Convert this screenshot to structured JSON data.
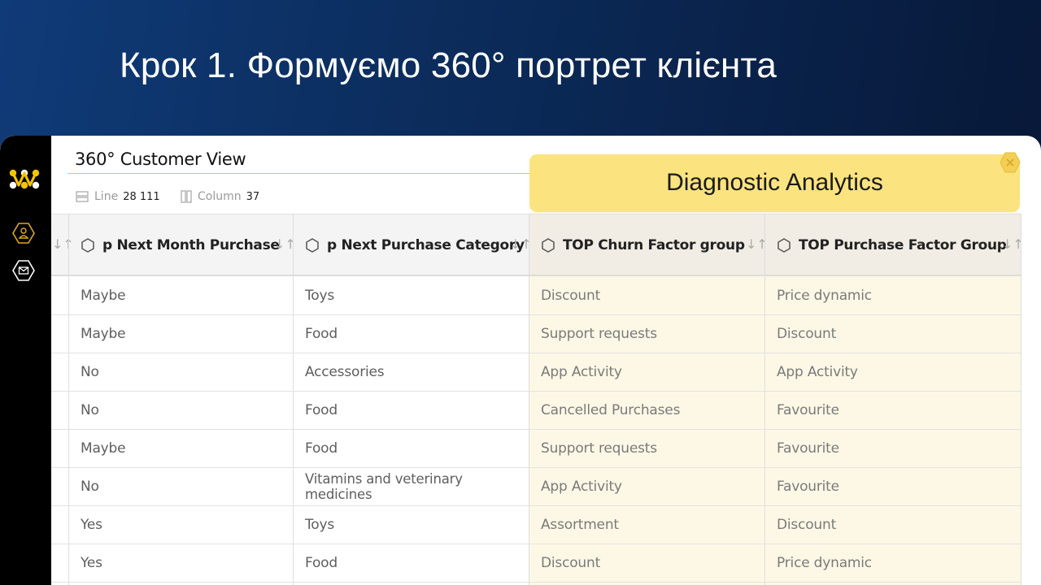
{
  "slide": {
    "title": "Крок 1. Формуємо 360° портрет клієнта"
  },
  "app": {
    "view_title": "360° Customer View",
    "meta": {
      "line_label": "Line",
      "line_count": "28 111",
      "column_label": "Column",
      "column_count": "37"
    },
    "sidebar": {
      "icons": [
        "logo-icon",
        "user-icon",
        "mail-icon"
      ]
    }
  },
  "callout": {
    "text": "Diagnostic Analytics"
  },
  "table": {
    "columns": [
      "p Next Month Purchase",
      "p Next Purchase Category",
      "TOP Churn Factor group",
      "TOP Purchase Factor Group"
    ],
    "rows": [
      [
        "Maybe",
        "Toys",
        "Discount",
        "Price dynamic"
      ],
      [
        "Maybe",
        "Food",
        "Support requests",
        "Discount"
      ],
      [
        "No",
        "Accessories",
        "App Activity",
        "App Activity"
      ],
      [
        "No",
        "Food",
        "Cancelled Purchases",
        "Favourite"
      ],
      [
        "Maybe",
        "Food",
        "Support requests",
        "Favourite"
      ],
      [
        "No",
        "Vitamins and veterinary medicines",
        "App Activity",
        "Favourite"
      ],
      [
        "Yes",
        "Toys",
        "Assortment",
        "Discount"
      ],
      [
        "Yes",
        "Food",
        "Discount",
        "Price dynamic"
      ]
    ]
  },
  "colors": {
    "accent": "#fbe27a",
    "background": "#0b2a58",
    "highlight": "#fdf8e6"
  }
}
